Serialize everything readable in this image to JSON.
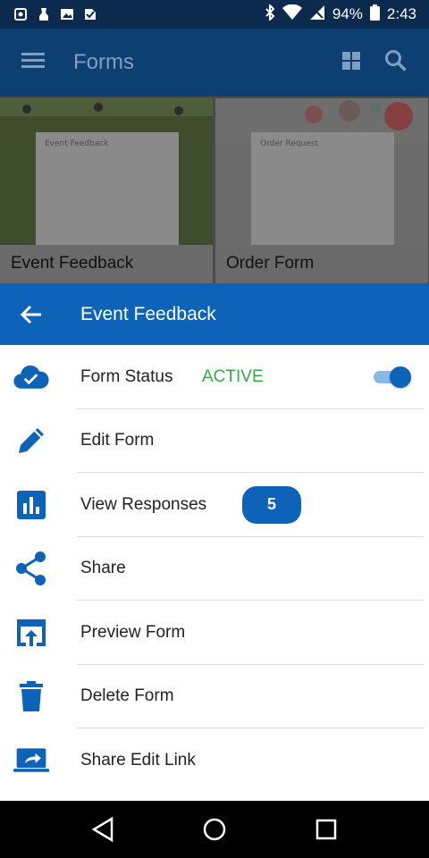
{
  "status_bar": {
    "battery": "94%",
    "time": "2:43",
    "icons": [
      "notification-icon",
      "notification-icon",
      "image-icon",
      "check-icon",
      "bluetooth-icon",
      "wifi-icon",
      "signal-icon",
      "battery-icon"
    ]
  },
  "appbar": {
    "title": "Forms",
    "icons": [
      "menu-icon",
      "grid-view-icon",
      "search-icon"
    ]
  },
  "cards": [
    {
      "caption": "Event Feedback",
      "paper_title": "Event Feedback"
    },
    {
      "caption": "Order Form",
      "paper_title": "Order Request"
    }
  ],
  "sheet": {
    "title": "Event Feedback",
    "items": [
      {
        "label": "Form Status",
        "status": "ACTIVE",
        "toggle_on": true,
        "icon": "cloud-check-icon"
      },
      {
        "label": "Edit Form",
        "icon": "pencil-icon"
      },
      {
        "label": "View Responses",
        "badge": "5",
        "icon": "bar-chart-icon"
      },
      {
        "label": "Share",
        "icon": "share-icon"
      },
      {
        "label": "Preview Form",
        "icon": "open-in-browser-icon"
      },
      {
        "label": "Delete Form",
        "icon": "trash-icon"
      },
      {
        "label": "Share Edit Link",
        "icon": "laptop-share-icon"
      }
    ]
  },
  "colors": {
    "accent": "#0d63b8",
    "active_green": "#39a64a",
    "statusbar": "#0c2a4d"
  },
  "navbar": {
    "icons": [
      "back-triangle-icon",
      "home-circle-icon",
      "recents-square-icon"
    ]
  }
}
